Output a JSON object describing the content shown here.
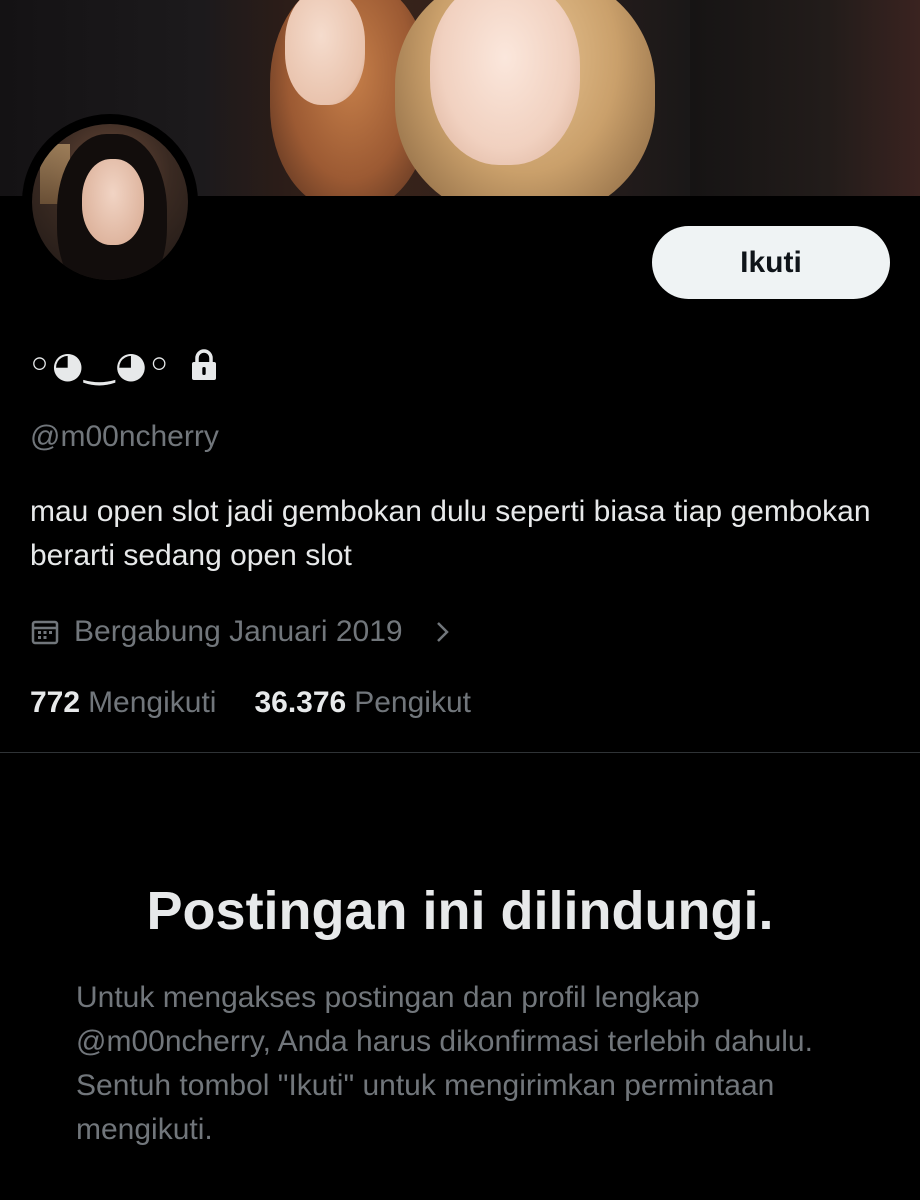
{
  "profile": {
    "display_name": "◦◕‿◕◦",
    "handle": "@m00ncherry",
    "bio": "mau open slot jadi gembokan dulu seperti biasa tiap gembokan berarti sedang open slot",
    "joined": "Bergabung Januari 2019",
    "following_count": "772",
    "following_label": "Mengikuti",
    "followers_count": "36.376",
    "followers_label": "Pengikut",
    "protected_icon": "lock-icon"
  },
  "actions": {
    "follow_label": "Ikuti"
  },
  "protected_notice": {
    "title": "Postingan ini dilindungi.",
    "body": "Untuk mengakses postingan dan profil lengkap @m00ncherry, Anda harus dikonfirmasi terlebih dahulu. Sentuh tombol \"Ikuti\" untuk mengirimkan permintaan mengikuti."
  },
  "icons": {
    "calendar": "calendar-icon",
    "chevron": "chevron-right-icon"
  },
  "colors": {
    "background": "#000000",
    "primary_text": "#e7e9ea",
    "secondary_text": "#71767b",
    "button_bg": "#eff3f4",
    "divider": "#2f3336"
  }
}
